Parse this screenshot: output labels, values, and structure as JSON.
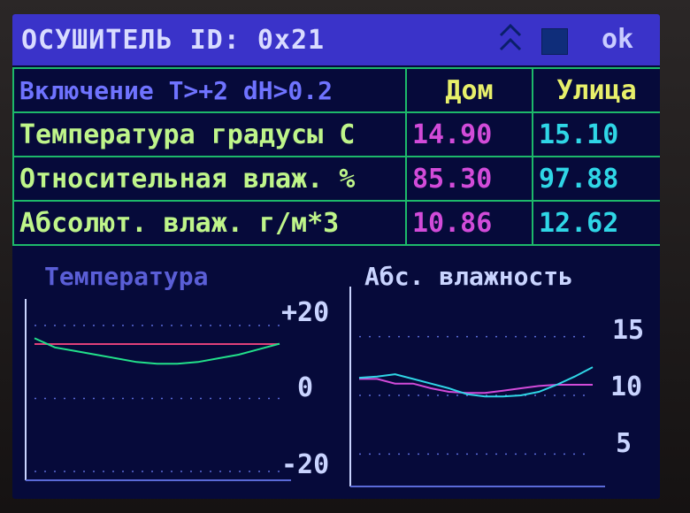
{
  "header": {
    "title": "ОСУШИТЕЛЬ ID: 0x21",
    "up_icon": "double-up-arrow-icon",
    "stop_icon": "stop-square-icon",
    "ok_label": "ok"
  },
  "table": {
    "header_label": "Включение T>+2 dH>0.2",
    "col_home": "Дом",
    "col_street": "Улица",
    "rows": [
      {
        "label": "Температура градусы C",
        "home": "14.90",
        "street": "15.10"
      },
      {
        "label": "Относительная влаж. %",
        "home": "85.30",
        "street": "97.88"
      },
      {
        "label": "Абсолют. влаж. г/м*3",
        "home": "10.86",
        "street": "12.62"
      }
    ]
  },
  "colors": {
    "background": "#060a3a",
    "title_bar": "#3a33c9",
    "grid": "#1db86a",
    "home": "#d24bd9",
    "street": "#2fd6e6",
    "temp_curve": "#22e08a",
    "temp_line": "#e0407a"
  },
  "chart_data": [
    {
      "type": "line",
      "title": "Температура",
      "tick_labels": [
        "+20",
        "0",
        "-20"
      ],
      "ylim": [
        -20,
        20
      ],
      "grid": "dotted",
      "series": [
        {
          "values": [
            14.9,
            14.9,
            14.9,
            14.9,
            14.9,
            14.9,
            14.9,
            14.9,
            14.9,
            14.9,
            14.9,
            14.9,
            14.9
          ]
        },
        {
          "values": [
            16.5,
            14.0,
            13.0,
            12.0,
            11.0,
            10.0,
            9.5,
            9.5,
            10.0,
            11.0,
            12.0,
            13.5,
            15.0
          ]
        }
      ]
    },
    {
      "type": "line",
      "title": "Абс. влажность",
      "tick_labels": [
        "15",
        "10",
        "5"
      ],
      "ylim": [
        3,
        17
      ],
      "grid": "dotted",
      "series": [
        {
          "values": [
            11.4,
            11.4,
            11.0,
            11.0,
            10.6,
            10.3,
            10.2,
            10.2,
            10.4,
            10.6,
            10.8,
            10.9,
            10.9,
            10.9
          ]
        },
        {
          "values": [
            11.5,
            11.6,
            11.8,
            11.4,
            11.0,
            10.6,
            10.1,
            9.9,
            9.9,
            10.0,
            10.3,
            10.9,
            11.6,
            12.4
          ]
        }
      ]
    }
  ]
}
